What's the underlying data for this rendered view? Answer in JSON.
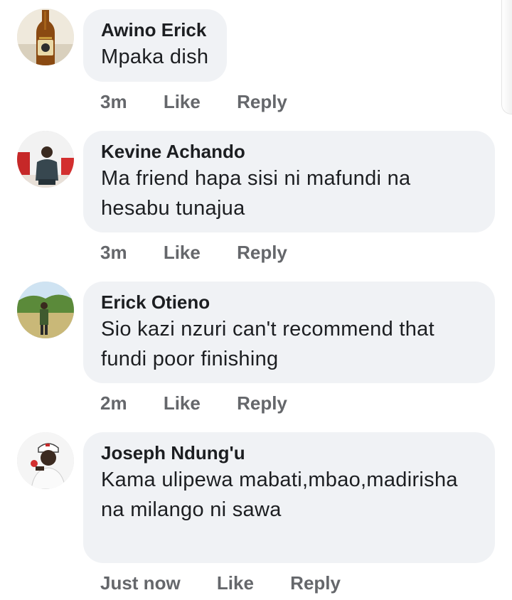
{
  "comments": [
    {
      "author": "Awino Erick",
      "text": "Mpaka dish",
      "time": "3m",
      "like": "Like",
      "reply": "Reply",
      "avatar": "beer-bottle-avatar"
    },
    {
      "author": "Kevine Achando",
      "text": "Ma friend hapa sisi ni mafundi na hesabu tunajua",
      "time": "3m",
      "like": "Like",
      "reply": "Reply",
      "avatar": "man-seated-avatar"
    },
    {
      "author": "Erick Otieno",
      "text": "Sio kazi nzuri can't recommend that fundi poor finishing",
      "time": "2m",
      "like": "Like",
      "reply": "Reply",
      "avatar": "man-outdoors-avatar"
    },
    {
      "author": "Joseph Ndung'u",
      "text": "Kama ulipewa mabati,mbao,madirisha na milango ni sawa",
      "time": "Just now",
      "like": "Like",
      "reply": "Reply",
      "avatar": "man-cap-avatar"
    }
  ],
  "colors": {
    "bubble_bg": "#f0f2f5",
    "text": "#1c1e21",
    "meta": "#65676b"
  }
}
